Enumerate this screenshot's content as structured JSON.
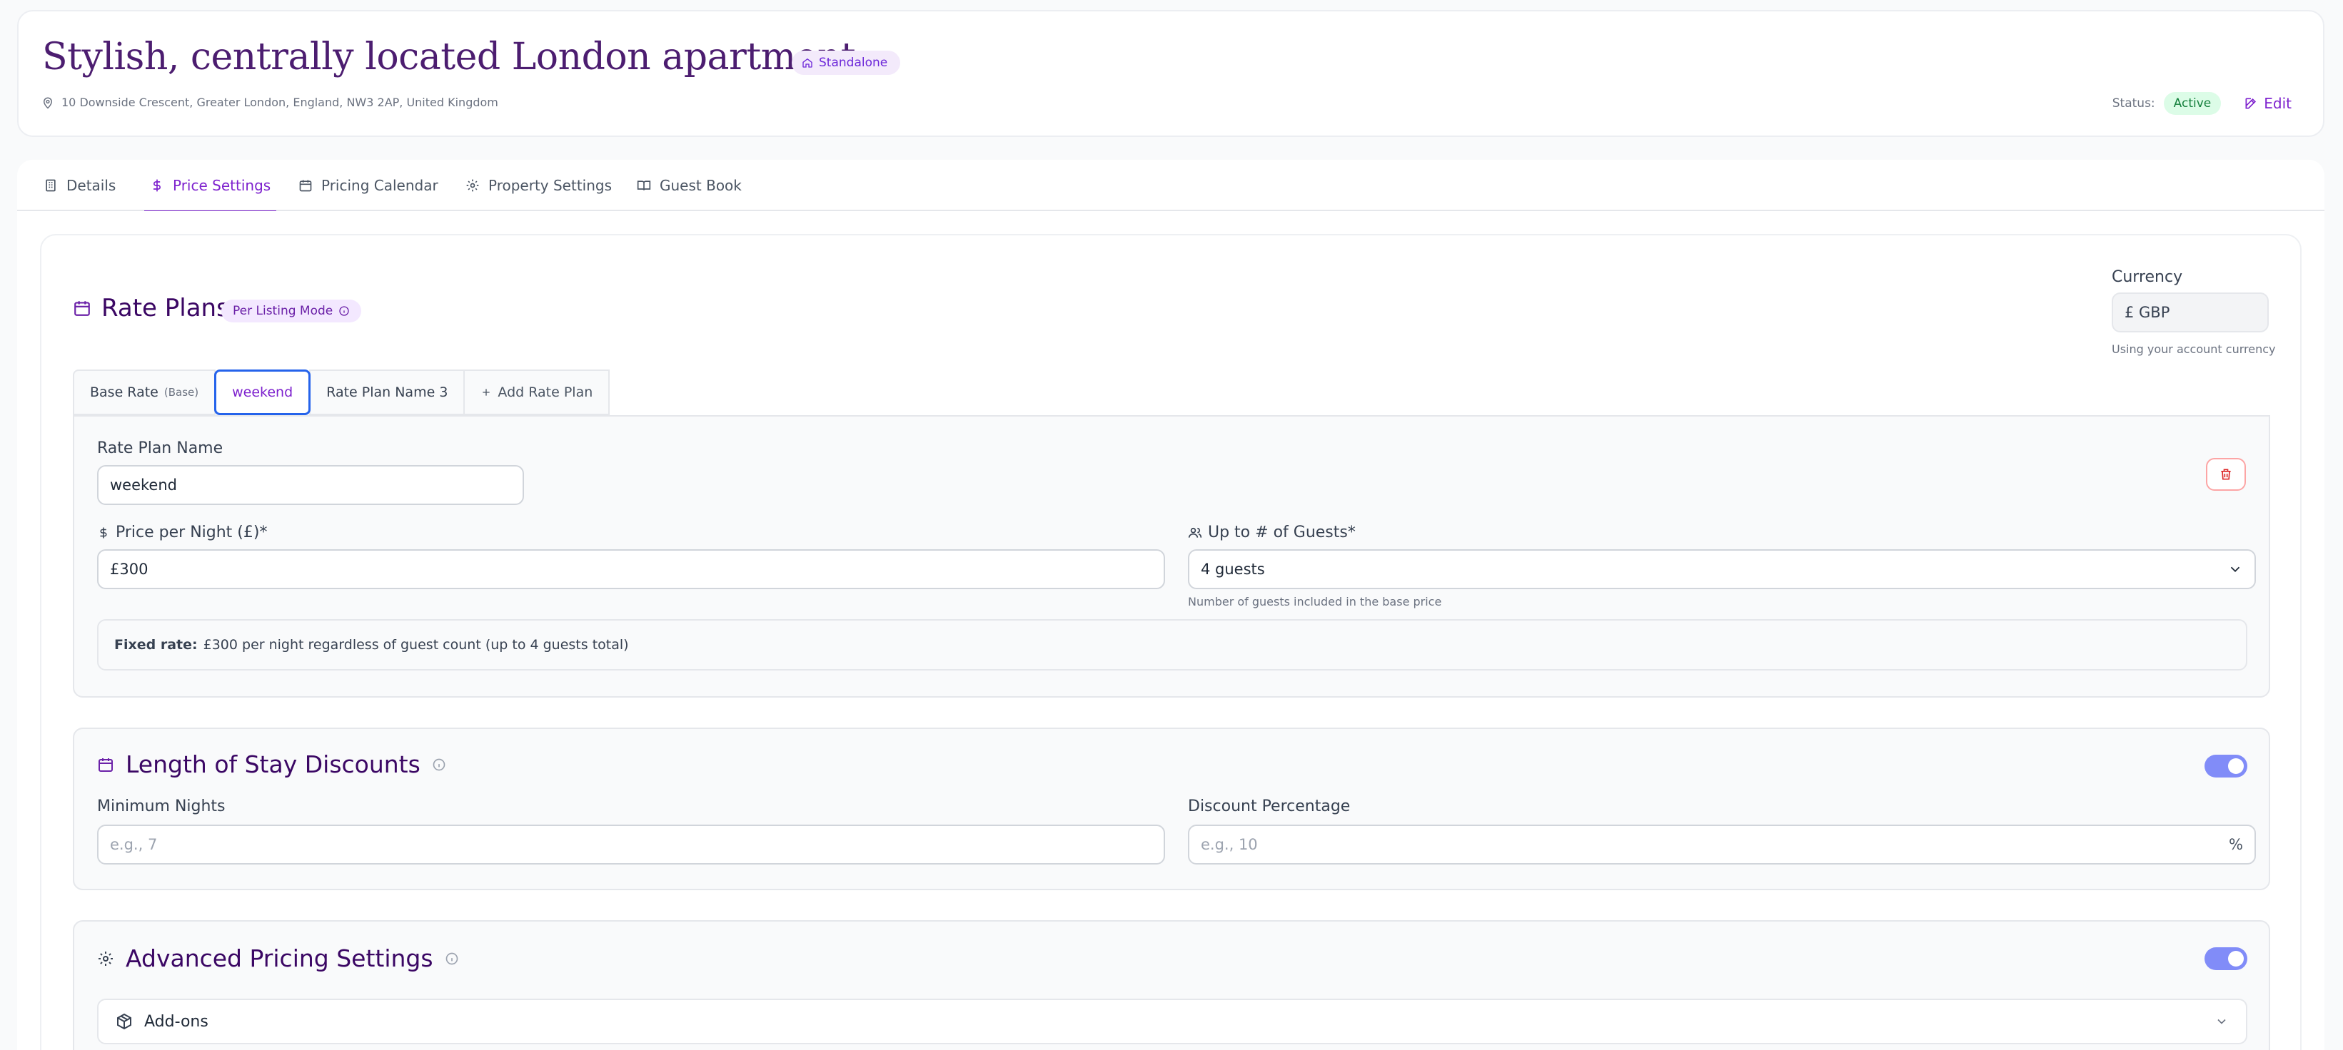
{
  "header": {
    "title": "Stylish, centrally located London apartment",
    "type_badge": "Standalone",
    "address": "10 Downside Crescent, Greater London, England, NW3 2AP, United Kingdom",
    "status_label": "Status:",
    "status_value": "Active",
    "edit_label": "Edit"
  },
  "tabs": [
    {
      "label": "Details",
      "icon": "building-icon"
    },
    {
      "label": "Price Settings",
      "icon": "dollar-icon",
      "active": true
    },
    {
      "label": "Pricing Calendar",
      "icon": "calendar-icon"
    },
    {
      "label": "Property Settings",
      "icon": "gear-icon"
    },
    {
      "label": "Guest Book",
      "icon": "book-icon"
    }
  ],
  "rate_plans": {
    "title": "Rate Plans",
    "mode_badge": "Per Listing Mode",
    "currency_label": "Currency",
    "currency_value": "£ GBP",
    "currency_help": "Using your account currency",
    "plans": [
      {
        "label": "Base Rate",
        "sub": "(Base)"
      },
      {
        "label": "weekend",
        "selected": true
      },
      {
        "label": "Rate Plan Name 3"
      }
    ],
    "add_label": "Add Rate Plan",
    "editor": {
      "name_label": "Rate Plan Name",
      "name_value": "weekend",
      "price_label": "Price per Night (£)*",
      "price_value": "£300",
      "guests_label": "Up to # of Guests*",
      "guests_value": "4 guests",
      "guests_help": "Number of guests included in the base price",
      "fixed_rate_label": "Fixed rate:",
      "fixed_rate_text": "£300 per night regardless of guest count (up to 4 guests total)"
    }
  },
  "length_of_stay": {
    "title": "Length of Stay Discounts",
    "enabled": true,
    "min_nights_label": "Minimum Nights",
    "min_nights_placeholder": "e.g., 7",
    "discount_label": "Discount Percentage",
    "discount_placeholder": "e.g., 10",
    "discount_suffix": "%"
  },
  "advanced": {
    "title": "Advanced Pricing Settings",
    "enabled": true,
    "addons_label": "Add-ons"
  },
  "colors": {
    "accent": "#7e22ce",
    "title": "#4c1d70",
    "toggle": "#818cf8",
    "active_status": "#15803d"
  }
}
